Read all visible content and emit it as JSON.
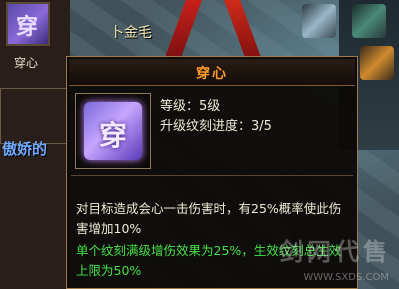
{
  "background": {
    "npc_name": "卜金毛",
    "other_player_name": "傲娇的",
    "slot_caption": "穿心",
    "slot_glyph": "穿"
  },
  "tooltip": {
    "title": "穿心",
    "icon_glyph": "穿",
    "level_line": "等级：5级",
    "progress_line": "升级纹刻进度：3/5",
    "description": "对目标造成会心一击伤害时，有25%概率使此伤害增加10%",
    "bonus_text": "单个纹刻满级增伤效果为25%，生效纹刻总生效上限为50%"
  },
  "watermark": {
    "text": "剑网代售",
    "url": "WWW.SXDS.COM"
  },
  "colors": {
    "title": "#ff9a2a",
    "bonus": "#46e048",
    "other_name": "#6ea8ff"
  }
}
